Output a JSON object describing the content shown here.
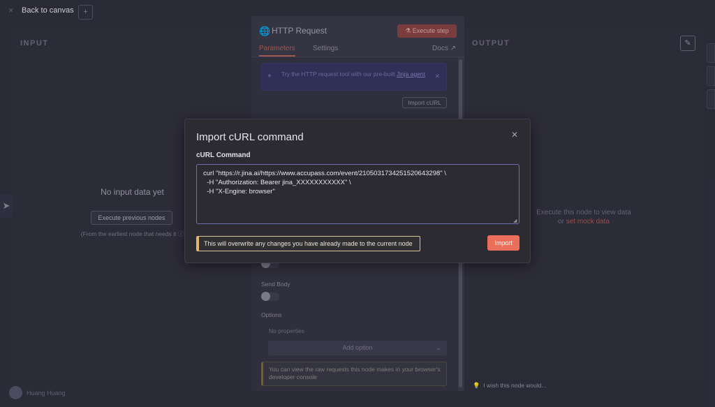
{
  "topbar": {
    "back_label": "Back to canvas",
    "back_icon": "close-icon",
    "add_icon": "plus-icon"
  },
  "input_panel": {
    "title": "INPUT",
    "empty_text": "No input data yet",
    "execute_previous_label": "Execute previous nodes",
    "earliest_note": "(From the earliest node that needs it ⓘ"
  },
  "output_panel": {
    "title": "OUTPUT",
    "hint_line1": "Execute this node to view data",
    "hint_or": "or",
    "mock_link": "set mock data",
    "edit_icon": "pencil-icon"
  },
  "node_panel": {
    "title": "HTTP Request",
    "icon": "globe-icon",
    "execute_step_label": "Execute step",
    "tabs": [
      {
        "label": "Parameters",
        "active": true
      },
      {
        "label": "Settings",
        "active": false
      }
    ],
    "docs_label": "Docs ↗",
    "banner_text": "Try the HTTP request tool with our pre-built",
    "banner_link": "Jinja agent",
    "import_curl_label": "Import cURL",
    "send_body_label": "Send Body",
    "options_label": "Options",
    "no_properties": "No properties",
    "add_option_label": "Add option",
    "console_note": "You can view the raw requests this node makes in your browser's developer console"
  },
  "footer": {
    "wish_label": "I wish this node would...",
    "user_name": "Huang Huang"
  },
  "modal": {
    "title": "Import cURL command",
    "field_label": "cURL Command",
    "curl_value": "curl \"https://r.jina.ai/https://www.accupass.com/event/2105031734251520643298\" \\\n  -H \"Authorization: Bearer jina_XXXXXXXXXXX\" \\\n  -H \"X-Engine: browser\"",
    "warning": "This will overwrite any changes you have already made to the current node",
    "import_label": "Import",
    "close_icon": "close-icon"
  },
  "colors": {
    "accent": "#ea6f5a",
    "focus": "#6e6fb6",
    "warning_border": "#e2b56b",
    "background": "#2f2e3c",
    "modal_bg": "#2b2b31"
  }
}
